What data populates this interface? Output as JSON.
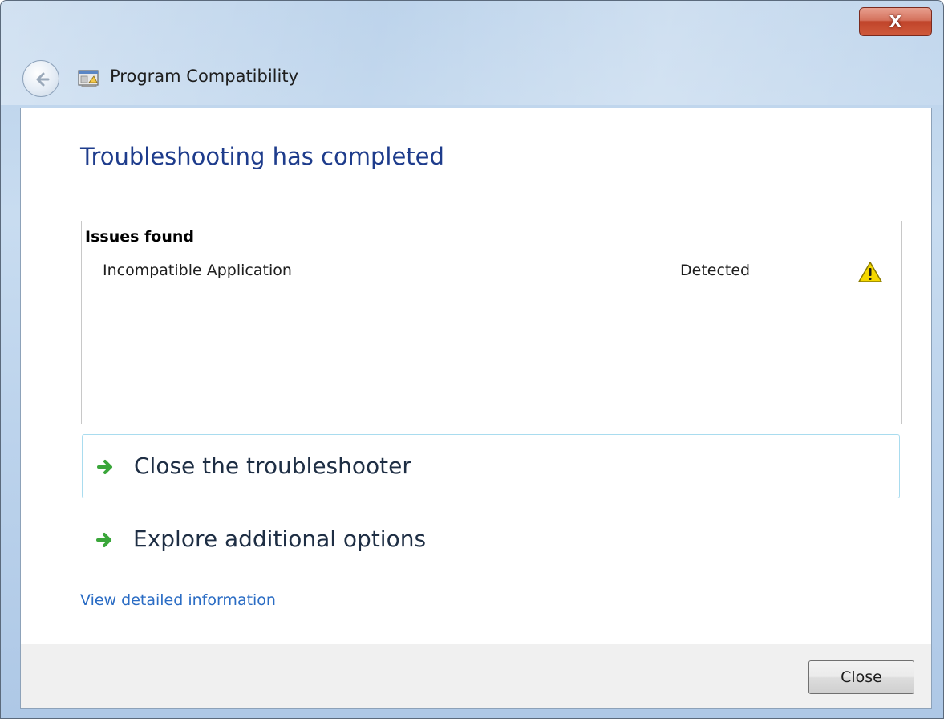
{
  "window": {
    "title": "Program Compatibility",
    "close_glyph": "X",
    "app_icon": "program-compatibility-icon"
  },
  "main": {
    "heading": "Troubleshooting has completed",
    "issues": {
      "header": "Issues found",
      "items": [
        {
          "name": "Incompatible Application",
          "status": "Detected",
          "icon": "warning-icon"
        }
      ]
    },
    "options": [
      {
        "label": "Close the troubleshooter",
        "icon": "green-arrow-icon",
        "selected": true
      },
      {
        "label": "Explore additional options",
        "icon": "green-arrow-icon",
        "selected": false
      }
    ],
    "detail_link": "View detailed information"
  },
  "footer": {
    "close_label": "Close"
  },
  "colors": {
    "heading": "#1e3c8c",
    "link": "#2a6cc4",
    "warning": "#f5d800",
    "arrow": "#3aa63a",
    "selection_border": "#a9dcef"
  }
}
